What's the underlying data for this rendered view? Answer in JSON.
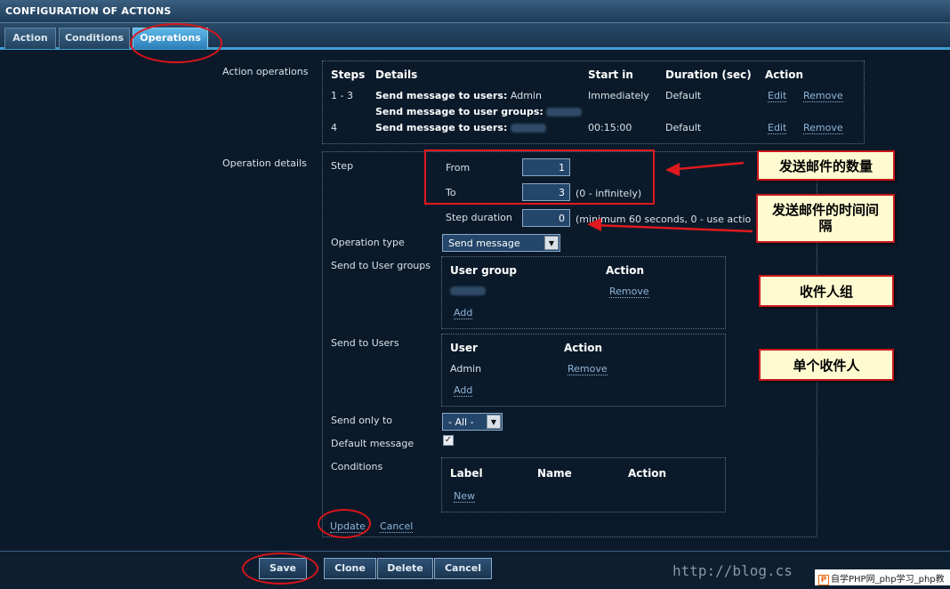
{
  "window_title": "CONFIGURATION OF ACTIONS",
  "tabs": [
    {
      "label": "Action",
      "active": false
    },
    {
      "label": "Conditions",
      "active": false
    },
    {
      "label": "Operations",
      "active": true
    }
  ],
  "action_operations": {
    "label": "Action operations",
    "headers": [
      "Steps",
      "Details",
      "Start in",
      "Duration (sec)",
      "Action"
    ],
    "rows": [
      {
        "steps": "1 - 3",
        "detail_prefix": "Send message to users:",
        "detail_value": "Admin",
        "detail2_prefix": "Send message to user groups:",
        "start_in": "Immediately",
        "duration": "Default",
        "edit": "Edit",
        "remove": "Remove"
      },
      {
        "steps": "4",
        "detail_prefix": "Send message to users:",
        "start_in": "00:15:00",
        "duration": "Default",
        "edit": "Edit",
        "remove": "Remove"
      }
    ]
  },
  "operation_details": {
    "label": "Operation details",
    "step_label": "Step",
    "from_label": "From",
    "from_value": "1",
    "to_label": "To",
    "to_value": "3",
    "to_hint": "(0 - infinitely)",
    "step_duration_label": "Step duration",
    "step_duration_value": "0",
    "step_duration_hint": "(minimum 60 seconds, 0 - use actio",
    "operation_type_label": "Operation type",
    "operation_type_value": "Send message",
    "user_groups_label": "Send to User groups",
    "user_groups_headers": [
      "User group",
      "Action"
    ],
    "user_groups_remove": "Remove",
    "user_groups_add": "Add",
    "users_label": "Send to Users",
    "users_headers": [
      "User",
      "Action"
    ],
    "users_rows": [
      {
        "user": "Admin",
        "remove": "Remove"
      }
    ],
    "users_add": "Add",
    "send_only_to_label": "Send only to",
    "send_only_to_value": "- All -",
    "default_message_label": "Default message",
    "default_message_checked": true,
    "conditions_label": "Conditions",
    "conditions_headers": [
      "Label",
      "Name",
      "Action"
    ],
    "conditions_new": "New",
    "update": "Update",
    "cancel": "Cancel"
  },
  "callouts": {
    "count": "发送邮件的数量",
    "interval": "发送邮件的时间间隔",
    "group": "收件人组",
    "single": "单个收件人"
  },
  "footer_buttons": {
    "save": "Save",
    "clone": "Clone",
    "delete": "Delete",
    "cancel": "Cancel"
  },
  "watermark": "http://blog.cs",
  "footer_badge": "自学PHP网_php学习_php教",
  "colors": {
    "background": "#0b1a2a",
    "accent": "#3f9fd0",
    "highlight_red": "#e0191e",
    "callout_bg": "#fffbd1"
  }
}
